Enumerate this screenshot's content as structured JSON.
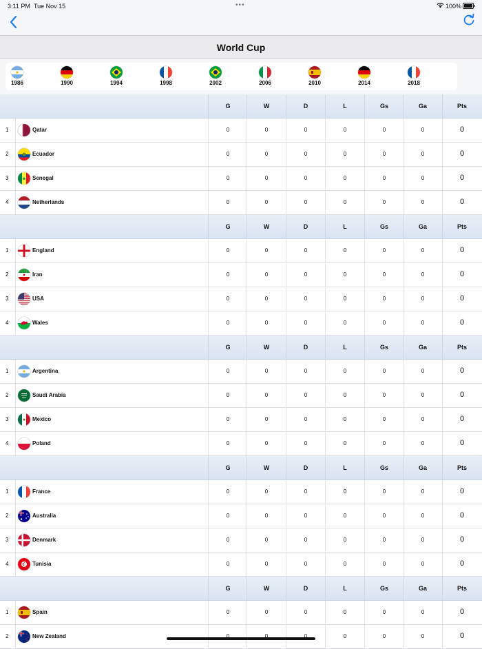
{
  "status_bar": {
    "time": "3:11 PM",
    "date": "Tue Nov 15",
    "dots": "•••",
    "battery": "100%"
  },
  "nav": {
    "back": "back",
    "refresh": "refresh"
  },
  "title": "World Cup",
  "years": [
    {
      "label": "1986",
      "flag": "argentina"
    },
    {
      "label": "1990",
      "flag": "germany"
    },
    {
      "label": "1994",
      "flag": "brazil"
    },
    {
      "label": "1998",
      "flag": "france"
    },
    {
      "label": "2002",
      "flag": "brazil"
    },
    {
      "label": "2006",
      "flag": "italy"
    },
    {
      "label": "2010",
      "flag": "spain"
    },
    {
      "label": "2014",
      "flag": "germany"
    },
    {
      "label": "2018",
      "flag": "france"
    }
  ],
  "columns": [
    "G",
    "W",
    "D",
    "L",
    "Gs",
    "Ga",
    "Pts"
  ],
  "groups": [
    {
      "teams": [
        {
          "pos": "1",
          "name": "Qatar",
          "flag": "qatar",
          "stats": [
            "0",
            "0",
            "0",
            "0",
            "0",
            "0"
          ],
          "pts": "0"
        },
        {
          "pos": "2",
          "name": "Ecuador",
          "flag": "ecuador",
          "stats": [
            "0",
            "0",
            "0",
            "0",
            "0",
            "0"
          ],
          "pts": "0"
        },
        {
          "pos": "3",
          "name": "Senegal",
          "flag": "senegal",
          "stats": [
            "0",
            "0",
            "0",
            "0",
            "0",
            "0"
          ],
          "pts": "0"
        },
        {
          "pos": "4",
          "name": "Netherlands",
          "flag": "netherlands",
          "stats": [
            "0",
            "0",
            "0",
            "0",
            "0",
            "0"
          ],
          "pts": "0"
        }
      ]
    },
    {
      "teams": [
        {
          "pos": "1",
          "name": "England",
          "flag": "england",
          "stats": [
            "0",
            "0",
            "0",
            "0",
            "0",
            "0"
          ],
          "pts": "0"
        },
        {
          "pos": "2",
          "name": "Iran",
          "flag": "iran",
          "stats": [
            "0",
            "0",
            "0",
            "0",
            "0",
            "0"
          ],
          "pts": "0"
        },
        {
          "pos": "3",
          "name": "USA",
          "flag": "usa",
          "stats": [
            "0",
            "0",
            "0",
            "0",
            "0",
            "0"
          ],
          "pts": "0"
        },
        {
          "pos": "4",
          "name": "Wales",
          "flag": "wales",
          "stats": [
            "0",
            "0",
            "0",
            "0",
            "0",
            "0"
          ],
          "pts": "0"
        }
      ]
    },
    {
      "teams": [
        {
          "pos": "1",
          "name": "Argentina",
          "flag": "argentina",
          "stats": [
            "0",
            "0",
            "0",
            "0",
            "0",
            "0"
          ],
          "pts": "0"
        },
        {
          "pos": "2",
          "name": "Saudi Arabia",
          "flag": "saudi",
          "stats": [
            "0",
            "0",
            "0",
            "0",
            "0",
            "0"
          ],
          "pts": "0"
        },
        {
          "pos": "3",
          "name": "Mexico",
          "flag": "mexico",
          "stats": [
            "0",
            "0",
            "0",
            "0",
            "0",
            "0"
          ],
          "pts": "0"
        },
        {
          "pos": "4",
          "name": "Poland",
          "flag": "poland",
          "stats": [
            "0",
            "0",
            "0",
            "0",
            "0",
            "0"
          ],
          "pts": "0"
        }
      ]
    },
    {
      "teams": [
        {
          "pos": "1",
          "name": "France",
          "flag": "france",
          "stats": [
            "0",
            "0",
            "0",
            "0",
            "0",
            "0"
          ],
          "pts": "0"
        },
        {
          "pos": "2",
          "name": "Australia",
          "flag": "australia",
          "stats": [
            "0",
            "0",
            "0",
            "0",
            "0",
            "0"
          ],
          "pts": "0"
        },
        {
          "pos": "3",
          "name": "Denmark",
          "flag": "denmark",
          "stats": [
            "0",
            "0",
            "0",
            "0",
            "0",
            "0"
          ],
          "pts": "0"
        },
        {
          "pos": "4",
          "name": "Tunisia",
          "flag": "tunisia",
          "stats": [
            "0",
            "0",
            "0",
            "0",
            "0",
            "0"
          ],
          "pts": "0"
        }
      ]
    },
    {
      "teams": [
        {
          "pos": "1",
          "name": "Spain",
          "flag": "spain",
          "stats": [
            "0",
            "0",
            "0",
            "0",
            "0",
            "0"
          ],
          "pts": "0"
        },
        {
          "pos": "2",
          "name": "New Zealand",
          "flag": "newzealand",
          "stats": [
            "0",
            "0",
            "0",
            "0",
            "0",
            "0"
          ],
          "pts": "0"
        }
      ]
    }
  ],
  "colors": {
    "accent": "#1a7cf5",
    "header_bg": "#dfe8f4"
  }
}
